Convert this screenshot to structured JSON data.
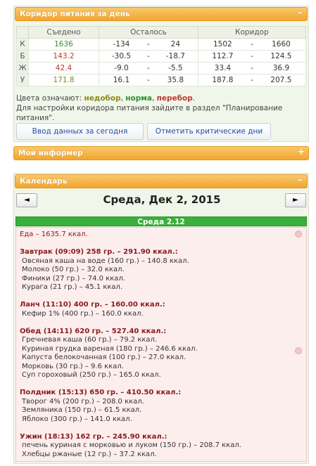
{
  "corridor": {
    "title": "Коридор питания за день",
    "toggle": "–",
    "headers": [
      "",
      "Съедено",
      "Осталось",
      "Коридор"
    ],
    "rows": [
      {
        "key": "К",
        "eaten": "1636",
        "left_a": "-134",
        "left_b": "24",
        "corr_a": "1502",
        "corr_b": "1660",
        "color": "#2f8f2f"
      },
      {
        "key": "Б",
        "eaten": "143.2",
        "left_a": "-30.5",
        "left_b": "-18.7",
        "corr_a": "112.7",
        "corr_b": "124.5",
        "color": "#c0392b"
      },
      {
        "key": "Ж",
        "eaten": "42.4",
        "left_a": "-9.0",
        "left_b": "-5.5",
        "corr_a": "33.4",
        "corr_b": "36.9",
        "color": "#c0392b"
      },
      {
        "key": "У",
        "eaten": "171.8",
        "left_a": "16.1",
        "left_b": "35.8",
        "corr_a": "187.8",
        "corr_b": "207.5",
        "color": "#8a8a1a"
      }
    ],
    "dash": "-",
    "colors_prefix": "Цвета означают: ",
    "legend_under": "недобор",
    "legend_norm": "норма",
    "legend_over": "перебор",
    "colors_suffix": ".",
    "hint": "Для настройки коридора питания зайдите в раздел \"Планирование питания\".",
    "btn_input": "Ввод данных за сегодня",
    "btn_critical": "Отметить критические дни"
  },
  "informer": {
    "title": "Мой информер",
    "toggle": "+"
  },
  "calendar": {
    "title": "Календарь",
    "toggle": "–",
    "prev": "◄",
    "next": "►",
    "date": "Среда, Дек 2, 2015",
    "day_label": "Среда 2.12",
    "total": "Еда – 1635.7 ккал.",
    "meals": [
      {
        "title": "Завтрак (09:09) 258 гр. – 291.90 ккал.:",
        "items": [
          "Овсяная каша на воде (160 гр.) – 140.8 ккал.",
          "Молоко (50 гр.) – 32.0 ккал.",
          "Финики (27 гр.) – 74.0 ккал.",
          "Курага (21 гр.) – 45.1 ккал."
        ]
      },
      {
        "title": "Ланч (11:10) 400 гр. – 160.00 ккал.:",
        "items": [
          "Кефир 1% (400 гр.) – 160.0 ккал."
        ]
      },
      {
        "title": "Обед (14:11) 620 гр. – 527.40 ккал.:",
        "items": [
          "Гречневая каша (60 гр.) – 79.2 ккал.",
          "Куриная грудка вареная (180 гр.) – 246.6 ккал.",
          "Капуста белокочанная (100 гр.) – 27.0 ккал.",
          "Морковь (30 гр.) – 9.6 ккал.",
          "Суп гороховый (250 гр.) – 165.0 ккал."
        ]
      },
      {
        "title": "Полдник (15:13) 650 гр. – 410.50 ккал.:",
        "items": [
          "Творог 4% (200 гр.) – 208.0 ккал.",
          "Земляника (150 гр.) – 61.5 ккал.",
          "Яблоко (300 гр.) – 141.0 ккал."
        ]
      },
      {
        "title": "Ужин (18:13) 162 гр. – 245.90 ккал.:",
        "items": [
          "печень куриная с морковью и луком (150 гр.) – 208.7 ккал.",
          "Хлебцы ржаные (12 гр.) – 37.2 ккал."
        ]
      }
    ]
  }
}
